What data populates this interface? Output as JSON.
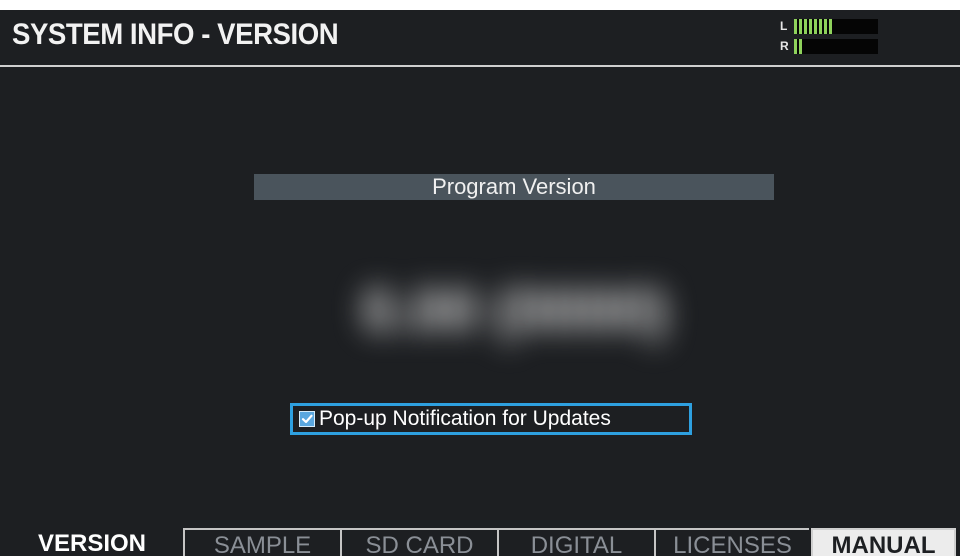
{
  "header": {
    "title": "SYSTEM INFO - VERSION"
  },
  "level_meter": {
    "left_label": "L",
    "right_label": "R",
    "left_level": 0.45,
    "right_level": 0.1,
    "color": "#8fd25c"
  },
  "main": {
    "program_version_label": "Program Version",
    "program_version_value": "0.00 (0000)",
    "popup_notification": {
      "label": "Pop-up Notification for Updates",
      "checked": true,
      "focus_color": "#2ea0e0"
    }
  },
  "tabs": [
    {
      "label": "VERSION",
      "state": "active"
    },
    {
      "label": "SAMPLE",
      "state": "inactive"
    },
    {
      "label": "SD CARD",
      "state": "inactive"
    },
    {
      "label": "DIGITAL",
      "state": "inactive"
    },
    {
      "label": "LICENSES",
      "state": "inactive"
    },
    {
      "label": "MANUAL",
      "state": "highlight"
    }
  ]
}
